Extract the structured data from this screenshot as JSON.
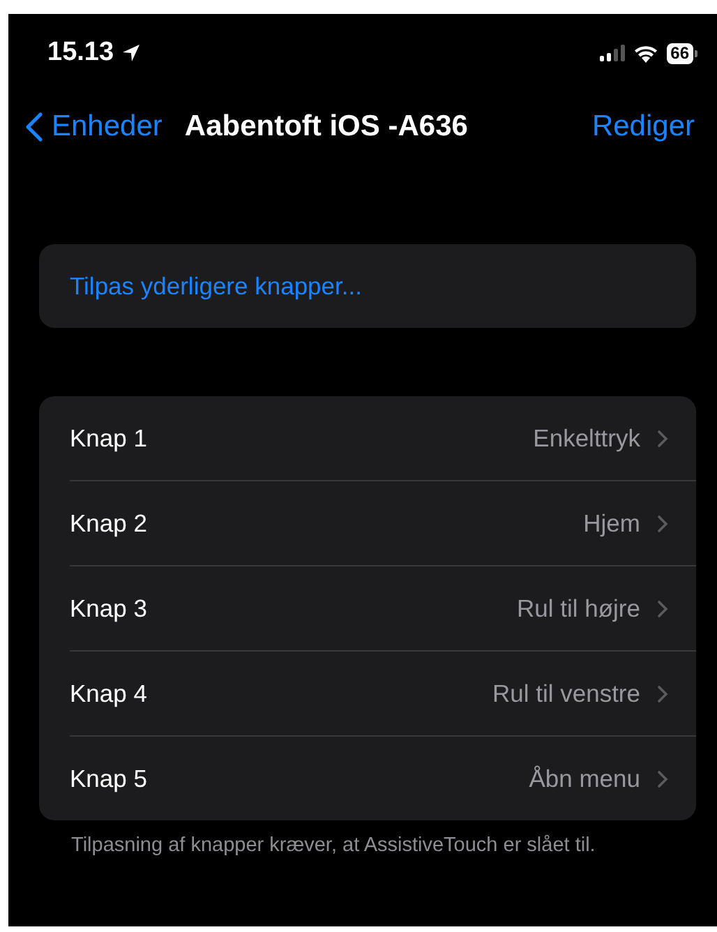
{
  "status_bar": {
    "time": "15.13",
    "battery": "66"
  },
  "nav": {
    "back": "Enheder",
    "title": "Aabentoft iOS -A636",
    "action": "Rediger"
  },
  "customize": {
    "label": "Tilpas yderligere knapper..."
  },
  "buttons": [
    {
      "label": "Knap 1",
      "value": "Enkelttryk"
    },
    {
      "label": "Knap 2",
      "value": "Hjem"
    },
    {
      "label": "Knap 3",
      "value": "Rul til højre"
    },
    {
      "label": "Knap 4",
      "value": "Rul til venstre"
    },
    {
      "label": "Knap 5",
      "value": "Åbn menu"
    }
  ],
  "footer": "Tilpasning af knapper kræver, at AssistiveTouch er slået til."
}
